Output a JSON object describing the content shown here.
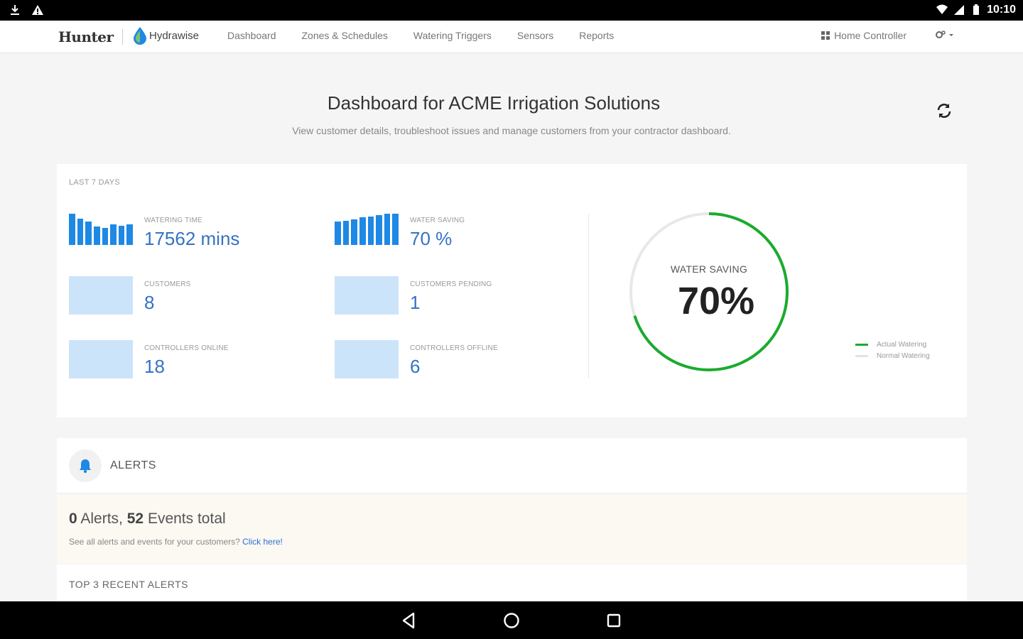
{
  "status_bar": {
    "time": "10:10",
    "left_icons": [
      "download-icon",
      "warning-icon"
    ],
    "right_icons": [
      "wifi-icon",
      "signal-icon",
      "battery-icon"
    ]
  },
  "nav": {
    "brand": "Hunter",
    "product": "Hydrawise",
    "items": [
      "Dashboard",
      "Zones & Schedules",
      "Watering Triggers",
      "Sensors",
      "Reports"
    ],
    "controller": "Home Controller"
  },
  "header": {
    "title": "Dashboard for ACME Irrigation Solutions",
    "subtitle": "View customer details, troubleshoot issues and manage customers from your contractor dashboard."
  },
  "stats": {
    "period_label": "LAST 7 DAYS",
    "items": [
      {
        "label": "WATERING TIME",
        "value": "17562 mins"
      },
      {
        "label": "WATER SAVING",
        "value": "70 %"
      },
      {
        "label": "CUSTOMERS",
        "value": "8"
      },
      {
        "label": "CUSTOMERS PENDING",
        "value": "1"
      },
      {
        "label": "CONTROLLERS ONLINE",
        "value": "18"
      },
      {
        "label": "CONTROLLERS OFFLINE",
        "value": "6"
      }
    ],
    "gauge": {
      "label": "WATER SAVING",
      "value": "70%",
      "fraction": 0.7,
      "color": "#1aab2e",
      "track_color": "#e8e8e8"
    },
    "legend": [
      {
        "label": "Actual Watering",
        "color": "#1aab2e"
      },
      {
        "label": "Normal Watering",
        "color": "#e3e3e3"
      }
    ],
    "watering_bars": [
      1.0,
      0.85,
      0.75,
      0.6,
      0.55,
      0.65,
      0.62,
      0.65
    ],
    "saving_bars": [
      0.75,
      0.78,
      0.82,
      0.88,
      0.92,
      0.96,
      1.0,
      1.0
    ],
    "accent": "#1e88e5"
  },
  "alerts": {
    "title": "ALERTS",
    "alert_count": "0",
    "alerts_word": "Alerts,",
    "event_count": "52",
    "events_word": "Events total",
    "hint": "See all alerts and events for your customers?",
    "link": "Click here!",
    "recent_title": "TOP 3 RECENT ALERTS"
  }
}
